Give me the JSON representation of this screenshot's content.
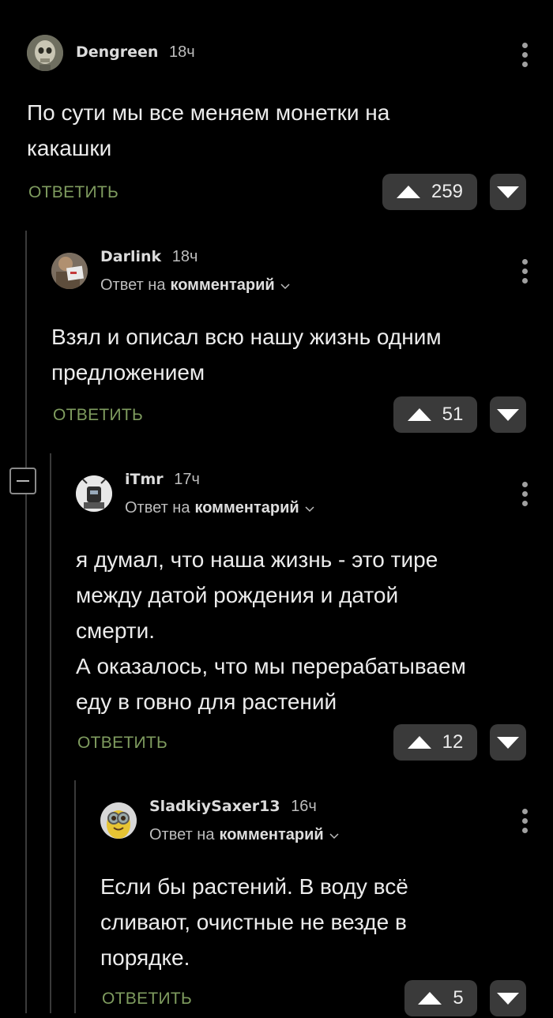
{
  "comments": [
    {
      "author": "Dengreen",
      "time": "18ч",
      "avatar_icon": "skull-avatar",
      "reply_prefix": "",
      "reply_target": "",
      "text": "По сути мы все меняем монетки на\nкакашки",
      "reply_label": "ОТВЕТИТЬ",
      "score": "259"
    },
    {
      "author": "Darlink",
      "time": "18ч",
      "avatar_icon": "person-with-paper-avatar",
      "reply_prefix": "Ответ на",
      "reply_target": "комментарий",
      "text": "Взял и описал всю нашу жизнь одним\nпредложением",
      "reply_label": "ОТВЕТИТЬ",
      "score": "51"
    },
    {
      "author": "iTmr",
      "time": "17ч",
      "avatar_icon": "robot-avatar",
      "reply_prefix": "Ответ на",
      "reply_target": "комментарий",
      "text": "я думал, что наша жизнь - это тире\nмежду датой рождения и датой\nсмерти.\nА оказалось, что мы перерабатываем\nеду в говно для растений",
      "reply_label": "ОТВЕТИТЬ",
      "score": "12"
    },
    {
      "author": "SladkiySaxer13",
      "time": "16ч",
      "avatar_icon": "minion-avatar",
      "reply_prefix": "Ответ на",
      "reply_target": "комментарий",
      "text": "Если бы растений. В воду всё\nсливают, очистные не везде в\nпорядке.",
      "reply_label": "ОТВЕТИТЬ",
      "score": "5"
    }
  ],
  "colors": {
    "background": "#000000",
    "reply_link": "#7f9c5f",
    "vote_button": "#3a3a3a",
    "thread_line": "#3a3a3a"
  }
}
